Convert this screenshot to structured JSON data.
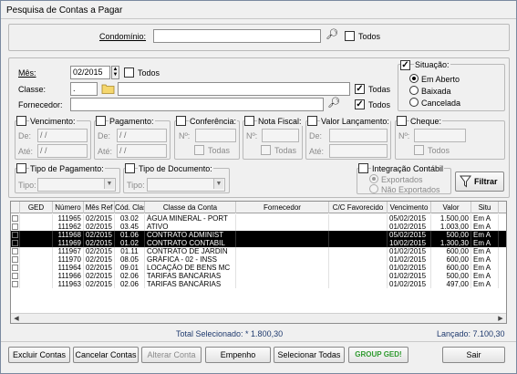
{
  "window": {
    "title": "Pesquisa de Contas a Pagar"
  },
  "condominio": {
    "label": "Condomínio:",
    "value": "",
    "todos_label": "Todos",
    "todos_checked": false
  },
  "mes": {
    "label": "Mês:",
    "value": "02/2015",
    "todos_label": "Todos",
    "todos_checked": false
  },
  "classe": {
    "label": "Classe:",
    "code": ".",
    "name": "",
    "todas_label": "Todas",
    "todas_checked": true
  },
  "fornecedor": {
    "label": "Fornecedor:",
    "value": "",
    "todos_label": "Todos",
    "todos_checked": true
  },
  "situacao": {
    "label": "Situação:",
    "checked": true,
    "options": [
      {
        "label": "Em Aberto",
        "selected": true
      },
      {
        "label": "Baixada",
        "selected": false
      },
      {
        "label": "Cancelada",
        "selected": false
      }
    ]
  },
  "vencimento": {
    "label": "Vencimento:",
    "de_label": "De:",
    "ate_label": "Até:",
    "de": "/ /",
    "ate": "/ /"
  },
  "pagamento": {
    "label": "Pagamento:",
    "de_label": "De:",
    "ate_label": "Até:",
    "de": "/ /",
    "ate": "/ /"
  },
  "conferencia": {
    "label": "Conferência:",
    "no_label": "Nº:",
    "todas_label": "Todas"
  },
  "nota_fiscal": {
    "label": "Nota Fiscal:",
    "no_label": "Nº:",
    "todas_label": "Todas"
  },
  "valor_lancamento": {
    "label": "Valor Lançamento:",
    "de_label": "De:",
    "ate_label": "Até:"
  },
  "cheque": {
    "label": "Cheque:",
    "no_label": "Nº:",
    "todos_label": "Todos"
  },
  "tipo_pagamento": {
    "label": "Tipo de Pagamento:",
    "tipo_label": "Tipo:",
    "value": ""
  },
  "tipo_documento": {
    "label": "Tipo de Documento:",
    "tipo_label": "Tipo:",
    "value": ""
  },
  "integracao": {
    "label": "Integração Contábil",
    "options": [
      {
        "label": "Exportados",
        "selected": true
      },
      {
        "label": "Não Exportados",
        "selected": false
      }
    ]
  },
  "filtrar_label": "Filtrar",
  "grid": {
    "columns": [
      "GED",
      "Número",
      "Mês Ref",
      "Cód. Classe",
      "Classe da Conta",
      "Fornecedor",
      "C/C Favorecido",
      "Vencimento",
      "Valor",
      "Situ"
    ],
    "rows": [
      {
        "numero": "111965",
        "mes": "02/2015",
        "cod": "03.02",
        "classe": "ÁGUA MINERAL - PORT",
        "fornecedor": "",
        "cc": "",
        "venc": "05/02/2015",
        "valor": "1.500,00",
        "sit": "Em A",
        "selected": false
      },
      {
        "numero": "111962",
        "mes": "02/2015",
        "cod": "03.45",
        "classe": "ATIVO",
        "fornecedor": "",
        "cc": "",
        "venc": "01/02/2015",
        "valor": "1.003,00",
        "sit": "Em A",
        "selected": false
      },
      {
        "numero": "111968",
        "mes": "02/2015",
        "cod": "01.06",
        "classe": "CONTRATO ADMINIST",
        "fornecedor": "",
        "cc": "",
        "venc": "05/02/2015",
        "valor": "500,00",
        "sit": "Em A",
        "selected": true
      },
      {
        "numero": "111969",
        "mes": "02/2015",
        "cod": "01.02",
        "classe": "CONTRATO CONTABIL",
        "fornecedor": "",
        "cc": "",
        "venc": "10/02/2015",
        "valor": "1.300,30",
        "sit": "Em A",
        "selected": true
      },
      {
        "numero": "111967",
        "mes": "02/2015",
        "cod": "01.11",
        "classe": "CONTRATO DE JARDIN",
        "fornecedor": "",
        "cc": "",
        "venc": "01/02/2015",
        "valor": "600,00",
        "sit": "Em A",
        "selected": false
      },
      {
        "numero": "111970",
        "mes": "02/2015",
        "cod": "08.05",
        "classe": "GRÁFICA - 02 - INSS",
        "fornecedor": "",
        "cc": "",
        "venc": "01/02/2015",
        "valor": "600,00",
        "sit": "Em A",
        "selected": false
      },
      {
        "numero": "111964",
        "mes": "02/2015",
        "cod": "09.01",
        "classe": "LOCAÇÃO DE BENS MC",
        "fornecedor": "",
        "cc": "",
        "venc": "01/02/2015",
        "valor": "600,00",
        "sit": "Em A",
        "selected": false
      },
      {
        "numero": "111966",
        "mes": "02/2015",
        "cod": "02.06",
        "classe": "TARIFAS BANCÁRIAS",
        "fornecedor": "",
        "cc": "",
        "venc": "01/02/2015",
        "valor": "500,00",
        "sit": "Em A",
        "selected": false
      },
      {
        "numero": "111963",
        "mes": "02/2015",
        "cod": "02.06",
        "classe": "TARIFAS BANCÁRIAS",
        "fornecedor": "",
        "cc": "",
        "venc": "01/02/2015",
        "valor": "497,00",
        "sit": "Em A",
        "selected": false
      }
    ]
  },
  "totals": {
    "selecionado": "Total Selecionado: * 1.800,30",
    "lancado": "Lançado: 7.100,30"
  },
  "buttons": {
    "excluir": "Excluir Contas",
    "cancelar": "Cancelar Contas",
    "alterar": "Alterar Conta",
    "empenho": "Empenho",
    "selecionar": "Selecionar Todas",
    "group_ged": "GROUP GED!",
    "sair": "Sair"
  },
  "colors": {
    "selected_row": "#000000",
    "totals_text": "#1f3a6e",
    "ged_green": "#2f9a2f"
  }
}
